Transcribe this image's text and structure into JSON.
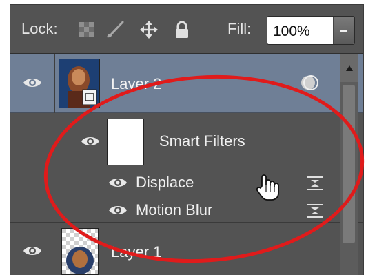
{
  "toolbar": {
    "lock_label": "Lock:",
    "lock_icons": [
      "transparency-lock-icon",
      "brush-lock-icon",
      "move-lock-icon",
      "padlock-icon"
    ],
    "fill_label": "Fill:",
    "fill_value": "100%"
  },
  "layers": [
    {
      "name": "Layer 2",
      "selected": true,
      "has_smart_filters": true
    },
    {
      "name": "Layer 1",
      "selected": false
    }
  ],
  "smart_filters": {
    "label": "Smart Filters",
    "items": [
      {
        "label": "Displace"
      },
      {
        "label": "Motion Blur"
      }
    ]
  },
  "colors": {
    "panel_bg": "#535353",
    "selected_row": "#6f7f96",
    "annotation_circle": "#e01b1b"
  }
}
